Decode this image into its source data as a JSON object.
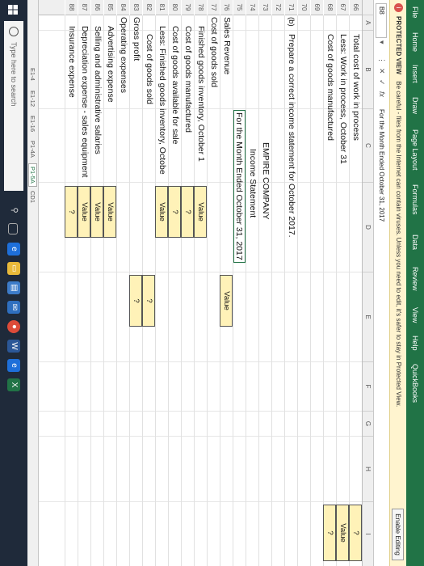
{
  "ribbon": {
    "tabs": [
      "File",
      "Home",
      "Insert",
      "Draw",
      "Page Layout",
      "Formulas",
      "Data",
      "Review",
      "View",
      "Help",
      "QuickBooks"
    ]
  },
  "protected_view": {
    "label": "PROTECTED VIEW",
    "message": "Be careful - files from the Internet can contain viruses. Unless you need to edit, it's safer to stay in Protected View.",
    "button": "Enable Editing"
  },
  "formula_bar": {
    "name_box": "B8",
    "cancel_icon": "✕",
    "enter_icon": "✓",
    "fx": "fx",
    "content": "For the Month Ended October 31, 2017"
  },
  "columns": [
    "A",
    "B",
    "C",
    "D",
    "E",
    "F",
    "G",
    "H",
    "I"
  ],
  "rows": [
    "66",
    "67",
    "68",
    "69",
    "70",
    "71",
    "72",
    "73",
    "74",
    "75",
    "76",
    "77",
    "78",
    "79",
    "80",
    "81",
    "82",
    "83",
    "84",
    "85",
    "86",
    "87",
    "88"
  ],
  "sheet": {
    "r66_label": "Total cost of work in process",
    "r66_value": "?",
    "r67_label": "Less: Work in process, October 31",
    "r67_value": "Value",
    "r68_label": "Cost of goods manufactured",
    "r68_value": "?",
    "r71_marker": "(b)",
    "r71_text": "Prepare a correct income statement for October 2017.",
    "r73_company": "EMPIRE COMPANY",
    "r74_title": "Income Statement",
    "r75_period": "For the Month Ended October 31, 2017",
    "r76_label": "Sales Revenue",
    "r76_value": "Value",
    "r77_label": "Cost of goods sold",
    "r78_label": "Finished goods inventory, October 1",
    "r78_value": "Value",
    "r79_label": "Cost of goods manufactured",
    "r79_value": "?",
    "r80_label": "Cost of goods available for sale",
    "r80_value": "?",
    "r81_label": "Less: Finished goods inventory, Octobe",
    "r81_value": "Value",
    "r82_label": "Cost of goods sold",
    "r82_value": "?",
    "r83_label": "Gross profit",
    "r83_value": "?",
    "r84_label": "Operating expenses",
    "r85_label": "Advertising expense",
    "r85_value": "Value",
    "r86_label": "Selling and administrative salaries",
    "r86_value": "Value",
    "r87_label": "Depreciation expense - sales equipment",
    "r87_value": "Value",
    "r88_label": "Insurance expense",
    "r88_value": "?"
  },
  "sheet_tabs": [
    "E1-4",
    "E1-12",
    "E1-16",
    "P1-4A",
    "P1-5A",
    "CD1"
  ],
  "active_sheet_tab": "P1-5A",
  "taskbar": {
    "search_placeholder": "Type here to search",
    "icons": [
      "task-view-icon",
      "edge-icon",
      "file-explorer-icon",
      "store-icon",
      "mail-icon",
      "chrome-icon",
      "word-icon",
      "edge-icon",
      "excel-icon"
    ]
  },
  "colors": {
    "excel_green": "#217346",
    "protected_bar": "#fff4cf",
    "value_cell": "#fff2b8",
    "taskbar": "#1f2a3a"
  }
}
